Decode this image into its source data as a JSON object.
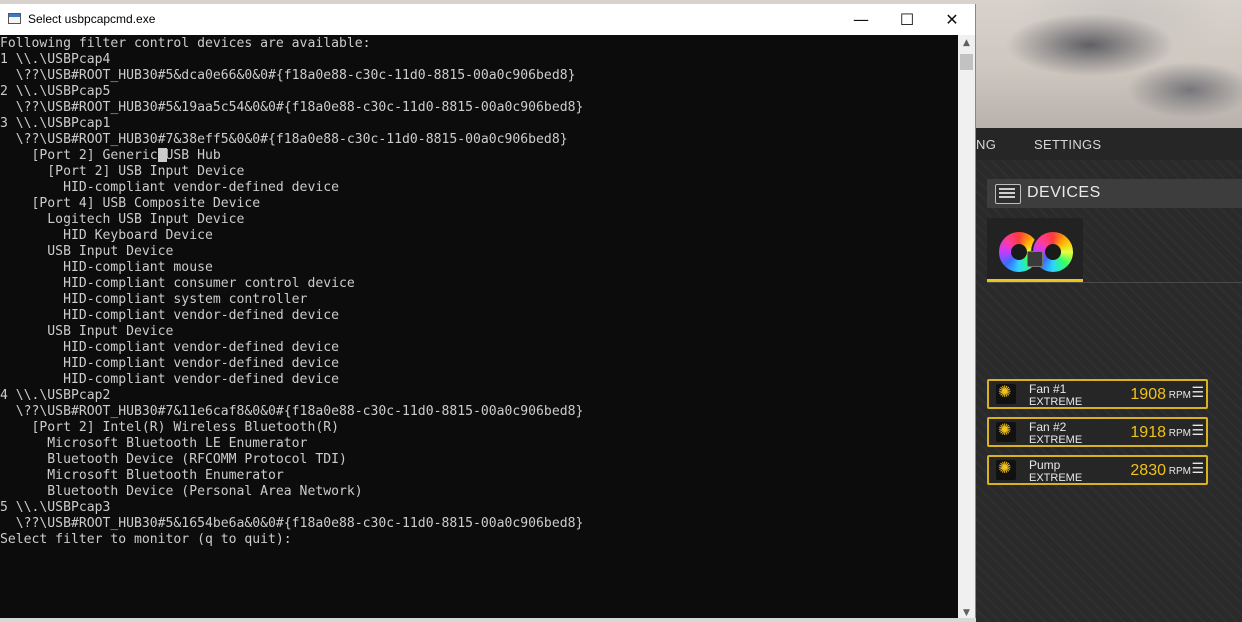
{
  "window": {
    "title": "Select usbpcapcmd.exe",
    "minimize_glyph": "—",
    "maximize_glyph": "☐",
    "close_glyph": "✕"
  },
  "console": {
    "lines": [
      "Following filter control devices are available:",
      "1 \\\\.\\USBPcap4",
      "  \\??\\USB#ROOT_HUB30#5&dca0e66&0&0#{f18a0e88-c30c-11d0-8815-00a0c906bed8}",
      "2 \\\\.\\USBPcap5",
      "  \\??\\USB#ROOT_HUB30#5&19aa5c54&0&0#{f18a0e88-c30c-11d0-8815-00a0c906bed8}",
      "3 \\\\.\\USBPcap1",
      "  \\??\\USB#ROOT_HUB30#7&38eff5&0&0#{f18a0e88-c30c-11d0-8815-00a0c906bed8}",
      "    [Port 2] Generic USB Hub",
      "      [Port 2] USB Input Device",
      "        HID-compliant vendor-defined device",
      "    [Port 4] USB Composite Device",
      "      Logitech USB Input Device",
      "        HID Keyboard Device",
      "      USB Input Device",
      "        HID-compliant mouse",
      "        HID-compliant consumer control device",
      "        HID-compliant system controller",
      "        HID-compliant vendor-defined device",
      "      USB Input Device",
      "        HID-compliant vendor-defined device",
      "        HID-compliant vendor-defined device",
      "        HID-compliant vendor-defined device",
      "4 \\\\.\\USBPcap2",
      "  \\??\\USB#ROOT_HUB30#7&11e6caf8&0&0#{f18a0e88-c30c-11d0-8815-00a0c906bed8}",
      "    [Port 2] Intel(R) Wireless Bluetooth(R)",
      "      Microsoft Bluetooth LE Enumerator",
      "      Bluetooth Device (RFCOMM Protocol TDI)",
      "      Microsoft Bluetooth Enumerator",
      "      Bluetooth Device (Personal Area Network)",
      "5 \\\\.\\USBPcap3",
      "  \\??\\USB#ROOT_HUB30#5&1654be6a&0&0#{f18a0e88-c30c-11d0-8815-00a0c906bed8}",
      "Select filter to monitor (q to quit):"
    ]
  },
  "scrollbar": {
    "up_glyph": "▲",
    "down_glyph": "▼"
  },
  "background_app": {
    "nav": {
      "partial_item": "NG",
      "settings": "SETTINGS"
    },
    "devices_title": "DEVICES",
    "fans": [
      {
        "name": "Fan #1",
        "mode": "EXTREME",
        "value": "1908",
        "unit": "RPM"
      },
      {
        "name": "Fan #2",
        "mode": "EXTREME",
        "value": "1918",
        "unit": "RPM"
      },
      {
        "name": "Pump",
        "mode": "EXTREME",
        "value": "2830",
        "unit": "RPM"
      }
    ],
    "fan_icon_glyph": "✺",
    "menu_glyph": "☰",
    "accent_color": "#f0c21a"
  }
}
